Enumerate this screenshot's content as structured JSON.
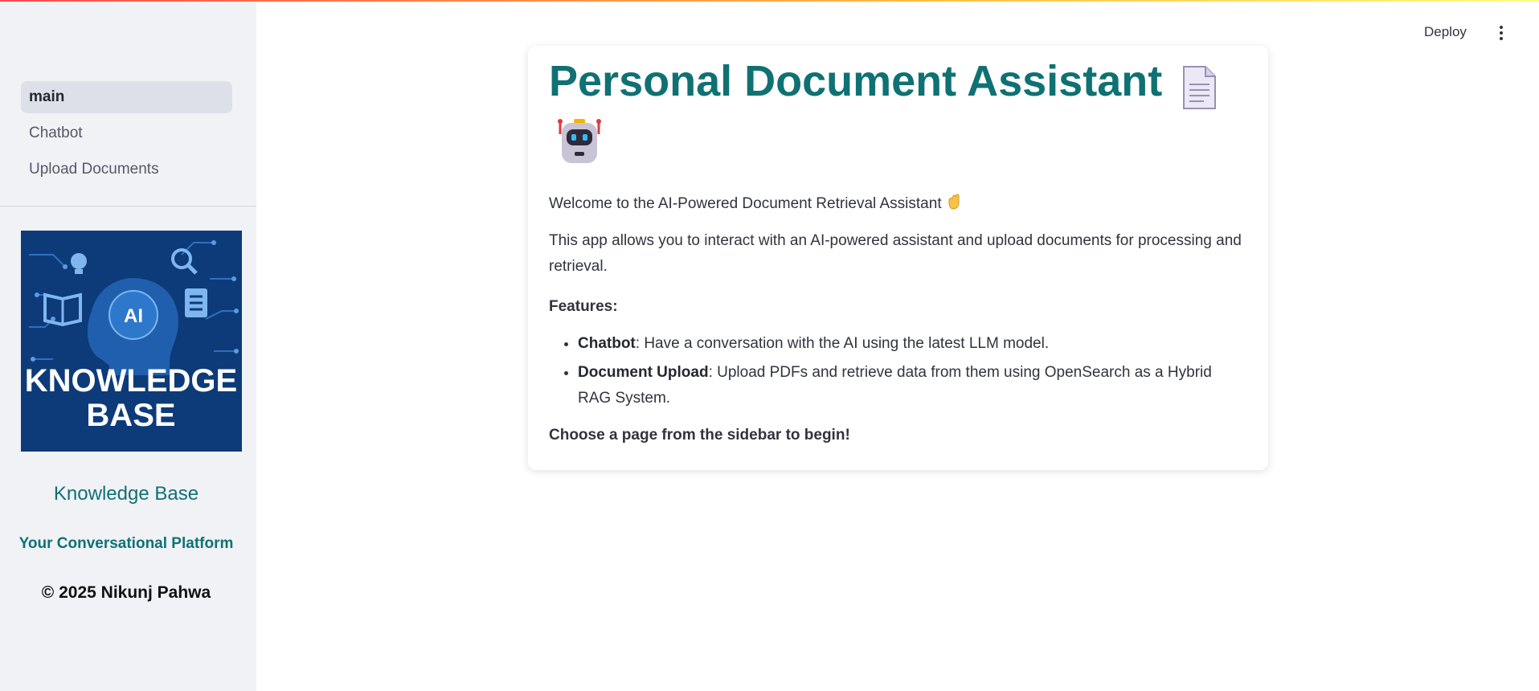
{
  "sidebar": {
    "nav": [
      {
        "label": "main",
        "active": true
      },
      {
        "label": "Chatbot",
        "active": false
      },
      {
        "label": "Upload Documents",
        "active": false
      }
    ],
    "image_text": {
      "line1": "KNOWLEDGE",
      "line2": "BASE",
      "ai": "AI"
    },
    "title": "Knowledge Base",
    "subtitle": "Your Conversational Platform",
    "copyright": "© 2025 Nikunj Pahwa"
  },
  "header": {
    "deploy_label": "Deploy",
    "menu_icon": "more-vertical-icon"
  },
  "main": {
    "title": "Personal Document Assistant",
    "title_icons": [
      "document-icon",
      "robot-icon"
    ],
    "welcome": "Welcome to the AI-Powered Document Retrieval Assistant",
    "description": "This app allows you to interact with an AI-powered assistant and upload documents for processing and retrieval.",
    "features_label": "Features:",
    "features": [
      {
        "name": "Chatbot",
        "text": ": Have a conversation with the AI using the latest LLM model."
      },
      {
        "name": "Document Upload",
        "text": ": Upload PDFs and retrieve data from them using OpenSearch as a Hybrid RAG System."
      }
    ],
    "cta": "Choose a page from the sidebar to begin!"
  },
  "colors": {
    "accent": "#0f7173",
    "sidebar_bg": "#f0f2f6",
    "active_nav_bg": "#dde0e9",
    "image_bg": "#0d3b7a"
  }
}
